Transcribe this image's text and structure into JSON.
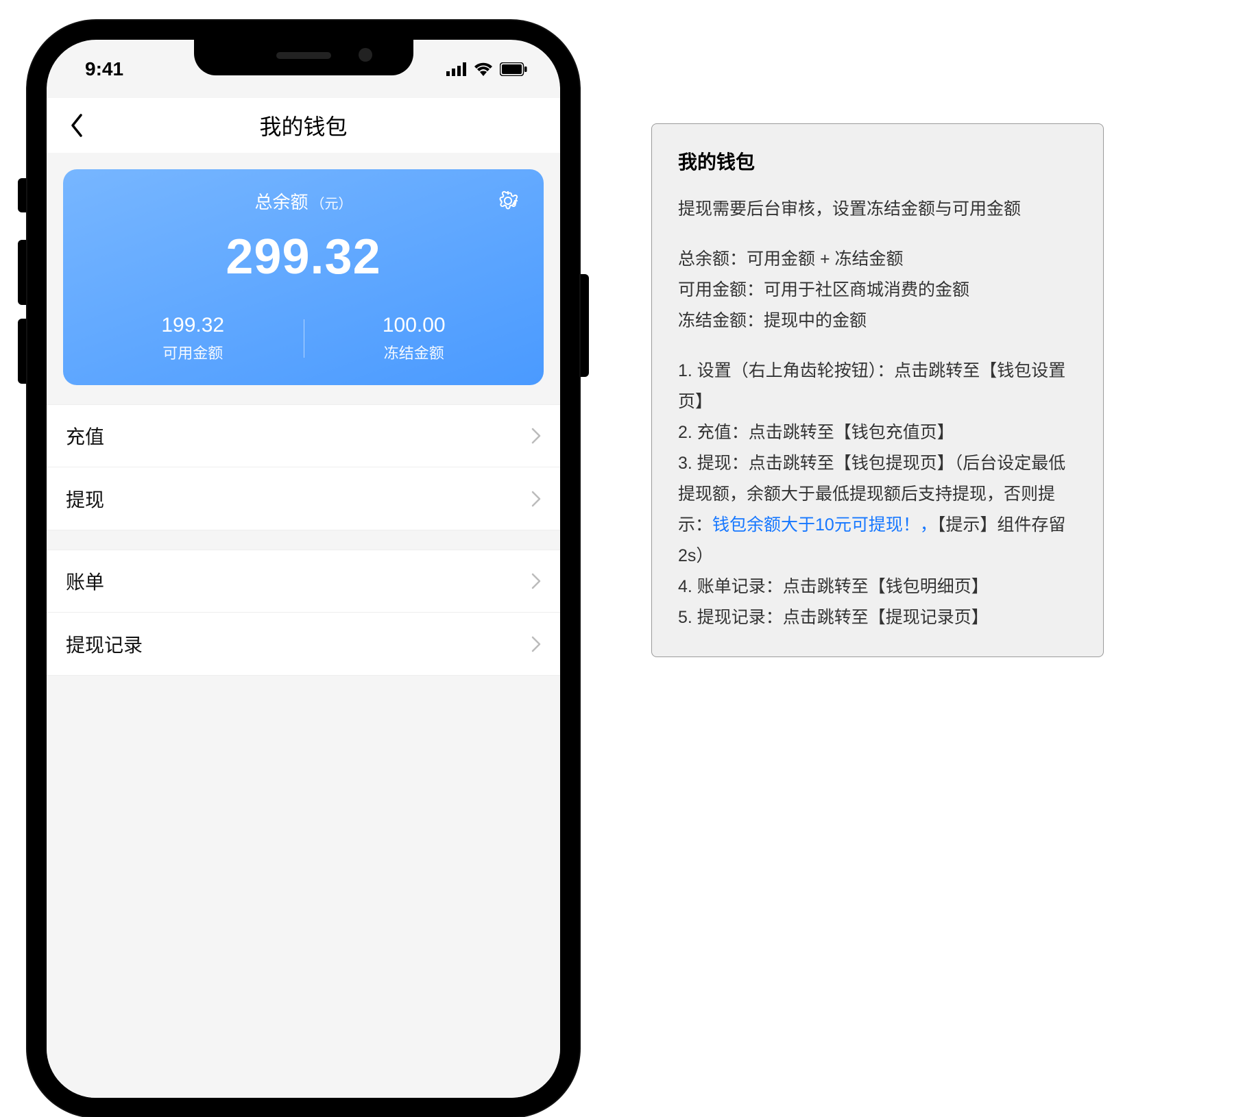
{
  "status_bar": {
    "time": "9:41"
  },
  "nav": {
    "title": "我的钱包"
  },
  "balance": {
    "label": "总余额",
    "unit": "（元）",
    "total": "299.32",
    "available_value": "199.32",
    "available_caption": "可用金额",
    "frozen_value": "100.00",
    "frozen_caption": "冻结金额"
  },
  "menu": {
    "group1": {
      "recharge": "充值",
      "withdraw": "提现"
    },
    "group2": {
      "bills": "账单",
      "withdraw_records": "提现记录"
    }
  },
  "note": {
    "title": "我的钱包",
    "subtitle": "提现需要后台审核，设置冻结金额与可用金额",
    "defs_line1": "总余额：可用金额 + 冻结金额",
    "defs_line2": "可用金额：可用于社区商城消费的金额",
    "defs_line3": "冻结金额：提现中的金额",
    "item1": "1. 设置（右上角齿轮按钮）：点击跳转至【钱包设置页】",
    "item2": "2. 充值：点击跳转至【钱包充值页】",
    "item3_prefix": "3. 提现：点击跳转至【钱包提现页】（后台设定最低提现额，余额大于最低提现额后支持提现，否则提示：",
    "item3_link": "钱包余额大于10元可提现！，",
    "item3_suffix": "【提示】组件存留2s）",
    "item4": "4. 账单记录：点击跳转至【钱包明细页】",
    "item5": "5. 提现记录：点击跳转至【提现记录页】"
  }
}
